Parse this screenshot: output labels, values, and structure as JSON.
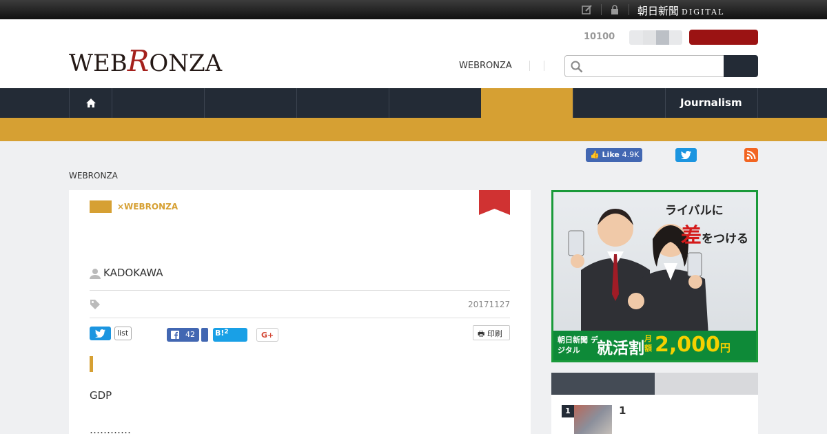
{
  "topbar": {
    "brand_main": "朝日新聞",
    "brand_sub": "DIGITAL"
  },
  "header": {
    "logo_pre": "WEB",
    "logo_r": "R",
    "logo_post": "ONZA",
    "count": "10100",
    "link": "WEBRONZA",
    "search_placeholder": ""
  },
  "nav": {
    "active_label": "",
    "journalism_label": "Journalism"
  },
  "social": {
    "fb_like_label": "Like",
    "fb_like_count": "4.9K"
  },
  "breadcrumb": "WEBRONZA",
  "article": {
    "category": "×WEBRONZA",
    "author": "KADOKAWA",
    "date": "20171127",
    "list_label": "list",
    "fb_count": "42",
    "hatena_label": "B!",
    "hatena_count": "2",
    "gplus_label": "G+",
    "print_label": "印刷",
    "body_line1": "GDP",
    "body_line2": "…………"
  },
  "ad": {
    "headline1": "ライバルに",
    "headline2_big": "差",
    "headline2_rest": "をつける",
    "footer_brand": "朝日新聞 デジタル",
    "footer_campaign": "就活割",
    "footer_month": "月額",
    "footer_price": "2,000",
    "footer_yen": "円"
  },
  "ranking": {
    "items": [
      {
        "rank": "1",
        "title": "1"
      }
    ]
  },
  "colors": {
    "gold": "#d6a033",
    "navy": "#232b36",
    "red": "#9b1313"
  }
}
